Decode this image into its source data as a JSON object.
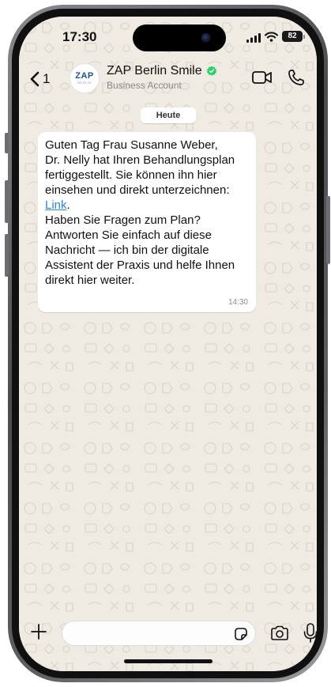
{
  "status_bar": {
    "time": "17:30",
    "battery": "82"
  },
  "header": {
    "back_count": "1",
    "avatar_logo": "ZAP",
    "avatar_sub": "BERLIN",
    "contact_name": "ZAP Berlin Smile",
    "contact_subtitle": "Business Account",
    "verified_color": "#25d366",
    "icons": [
      "chevron-left-icon",
      "verified-badge-icon",
      "video-camera-icon",
      "phone-icon"
    ]
  },
  "chat": {
    "date_chip": "Heute",
    "messages": [
      {
        "text_before_link": "Guten Tag Frau Susanne Weber,\nDr. Nelly hat Ihren Behandlungsplan fertiggestellt. Sie können ihn hier einsehen und direkt unterzeichnen: ",
        "link_text": "Link",
        "text_after_link": ".\nHaben Sie Fragen zum Plan? Antworten Sie einfach auf diese Nachricht — ich bin der digitale Assistent der Praxis und helfe Ihnen direkt hier weiter.",
        "time": "14:30"
      }
    ]
  },
  "composer": {
    "input_value": "",
    "icons": [
      "plus-icon",
      "sticker-icon",
      "camera-icon",
      "microphone-icon"
    ]
  },
  "colors": {
    "chat_background": "#efeae2",
    "bubble": "#ffffff",
    "link": "#2f86d3"
  }
}
